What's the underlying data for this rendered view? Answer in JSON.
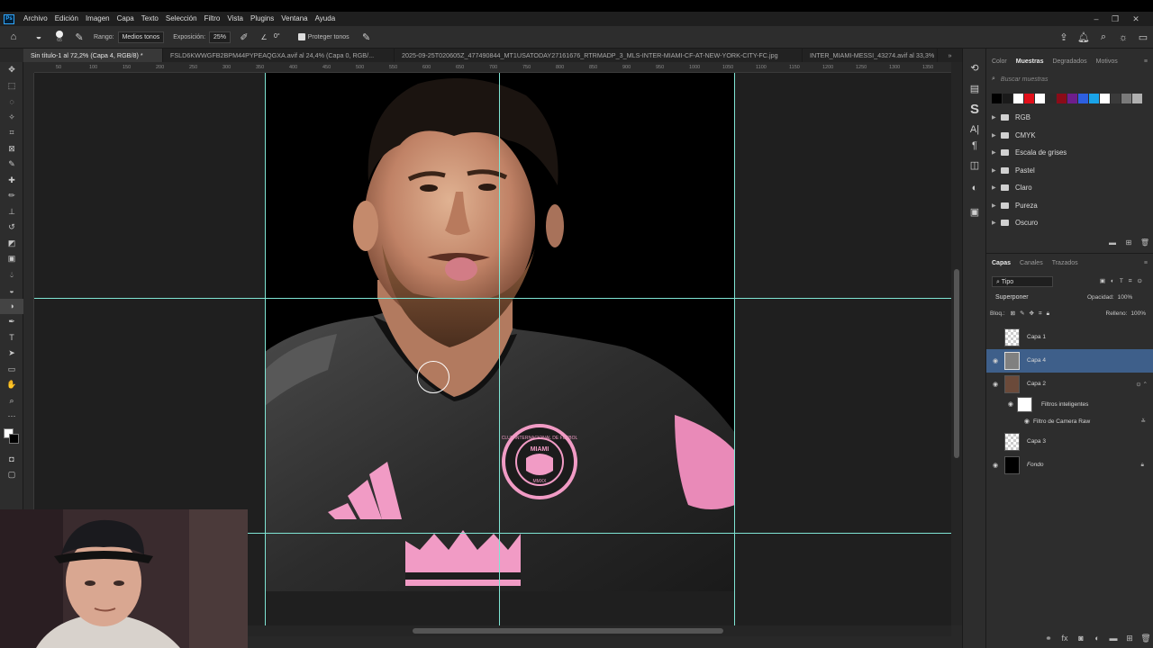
{
  "menu": {
    "app_logo": "Ps",
    "items": [
      "Archivo",
      "Edición",
      "Imagen",
      "Capa",
      "Texto",
      "Selección",
      "Filtro",
      "Vista",
      "Plugins",
      "Ventana",
      "Ayuda"
    ]
  },
  "options": {
    "brush_size": "65",
    "rango_label": "Rango:",
    "rango_value": "Medios tonos",
    "exposicion_label": "Exposición:",
    "exposicion_value": "25%",
    "angle_value": "0°",
    "proteger_label": "Proteger tonos"
  },
  "tabs": [
    {
      "label": "Sin título-1 al 72,2% (Capa 4, RGB/8) *",
      "active": true
    },
    {
      "label": "FSLD6KWWGFB2BPM44PYPEAQGXA.avif al 24,4% (Capa 0, RGB/...",
      "active": false
    },
    {
      "label": "2025-09-25T020605Z_477490844_MT1USATODAY27161676_RTRMADP_3_MLS-INTER-MIAMI-CF-AT-NEW-YORK-CITY-FC.jpg",
      "active": false
    },
    {
      "label": "INTER_MIAMI-MESSI_43274.avif al 33,3%",
      "active": false
    }
  ],
  "ruler_ticks": [
    "50",
    "100",
    "150",
    "200",
    "250",
    "300",
    "350",
    "400",
    "450",
    "500",
    "550",
    "600",
    "650",
    "700",
    "750",
    "800",
    "850",
    "900",
    "950",
    "1000",
    "1050",
    "1100",
    "1150",
    "1200",
    "1250",
    "1300",
    "1350",
    "1400"
  ],
  "swatches": {
    "tabs": [
      "Color",
      "Muestras",
      "Degradados",
      "Motivos"
    ],
    "active_tab": "Muestras",
    "search_placeholder": "Buscar muestras",
    "colors": [
      "#000000",
      "#1a1a1a",
      "#ffffff",
      "#e10f1a",
      "#ffffff",
      "#2b2b2b",
      "#8b0b18",
      "#6e1e8c",
      "#2d5fe0",
      "#1aa3e8",
      "#ffffff",
      "#3a3a3a",
      "#7a7a7a",
      "#b0b0b0"
    ],
    "folders": [
      "RGB",
      "CMYK",
      "Escala de grises",
      "Pastel",
      "Claro",
      "Pureza",
      "Oscuro"
    ]
  },
  "layers": {
    "tabs": [
      "Capas",
      "Canales",
      "Trazados"
    ],
    "active_tab": "Capas",
    "filter_label": "Tipo",
    "blend_mode": "Superponer",
    "opacity_label": "Opacidad:",
    "opacity_value": "100%",
    "lock_label": "Bloq.:",
    "fill_label": "Relleno:",
    "fill_value": "100%",
    "items": [
      {
        "name": "Capa 1",
        "visible": false
      },
      {
        "name": "Capa 4",
        "visible": true,
        "selected": true
      },
      {
        "name": "Capa 2",
        "visible": true
      },
      {
        "name": "Filtros inteligentes",
        "visible": true
      },
      {
        "name": "Filtro de Camera Raw",
        "visible": true
      },
      {
        "name": "Capa 3",
        "visible": false
      },
      {
        "name": "Fondo",
        "visible": true
      }
    ]
  },
  "jersey": {
    "crest_top": "MIAMI",
    "crest_ring": "CLUB INTERNACIONAL DE FÚTBOL",
    "crest_year": "MMXX"
  },
  "colors": {
    "guide": "#7fe5d4",
    "jersey_pink": "#f19bc5",
    "selected_layer": "#3e5f8a"
  }
}
